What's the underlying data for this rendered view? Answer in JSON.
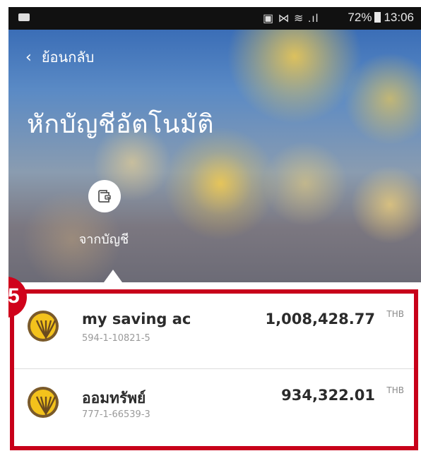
{
  "status_bar": {
    "icons": "▣ ⋈ ≋ .ıl",
    "battery": "72%",
    "time": "13:06"
  },
  "header": {
    "back_label": "ย้อนกลับ",
    "title": "หักบัญชีอัตโนมัติ",
    "source_label": "จากบัญชี"
  },
  "step_badge": "5",
  "accounts": [
    {
      "name": "my saving ac",
      "number": "594-1-10821-5",
      "amount": "1,008,428.77",
      "currency": "THB"
    },
    {
      "name": "ออมทรัพย์",
      "number": "777-1-66539-3",
      "amount": "934,322.01",
      "currency": "THB"
    }
  ],
  "colors": {
    "highlight": "#c8001a",
    "badge": "#d0021b",
    "logo_yellow": "#f3c21c",
    "logo_brown": "#7a5a2a"
  },
  "icons": {
    "back": "chevron-left-icon",
    "source": "wallet-icon",
    "bank": "krungsri-logo-icon"
  }
}
